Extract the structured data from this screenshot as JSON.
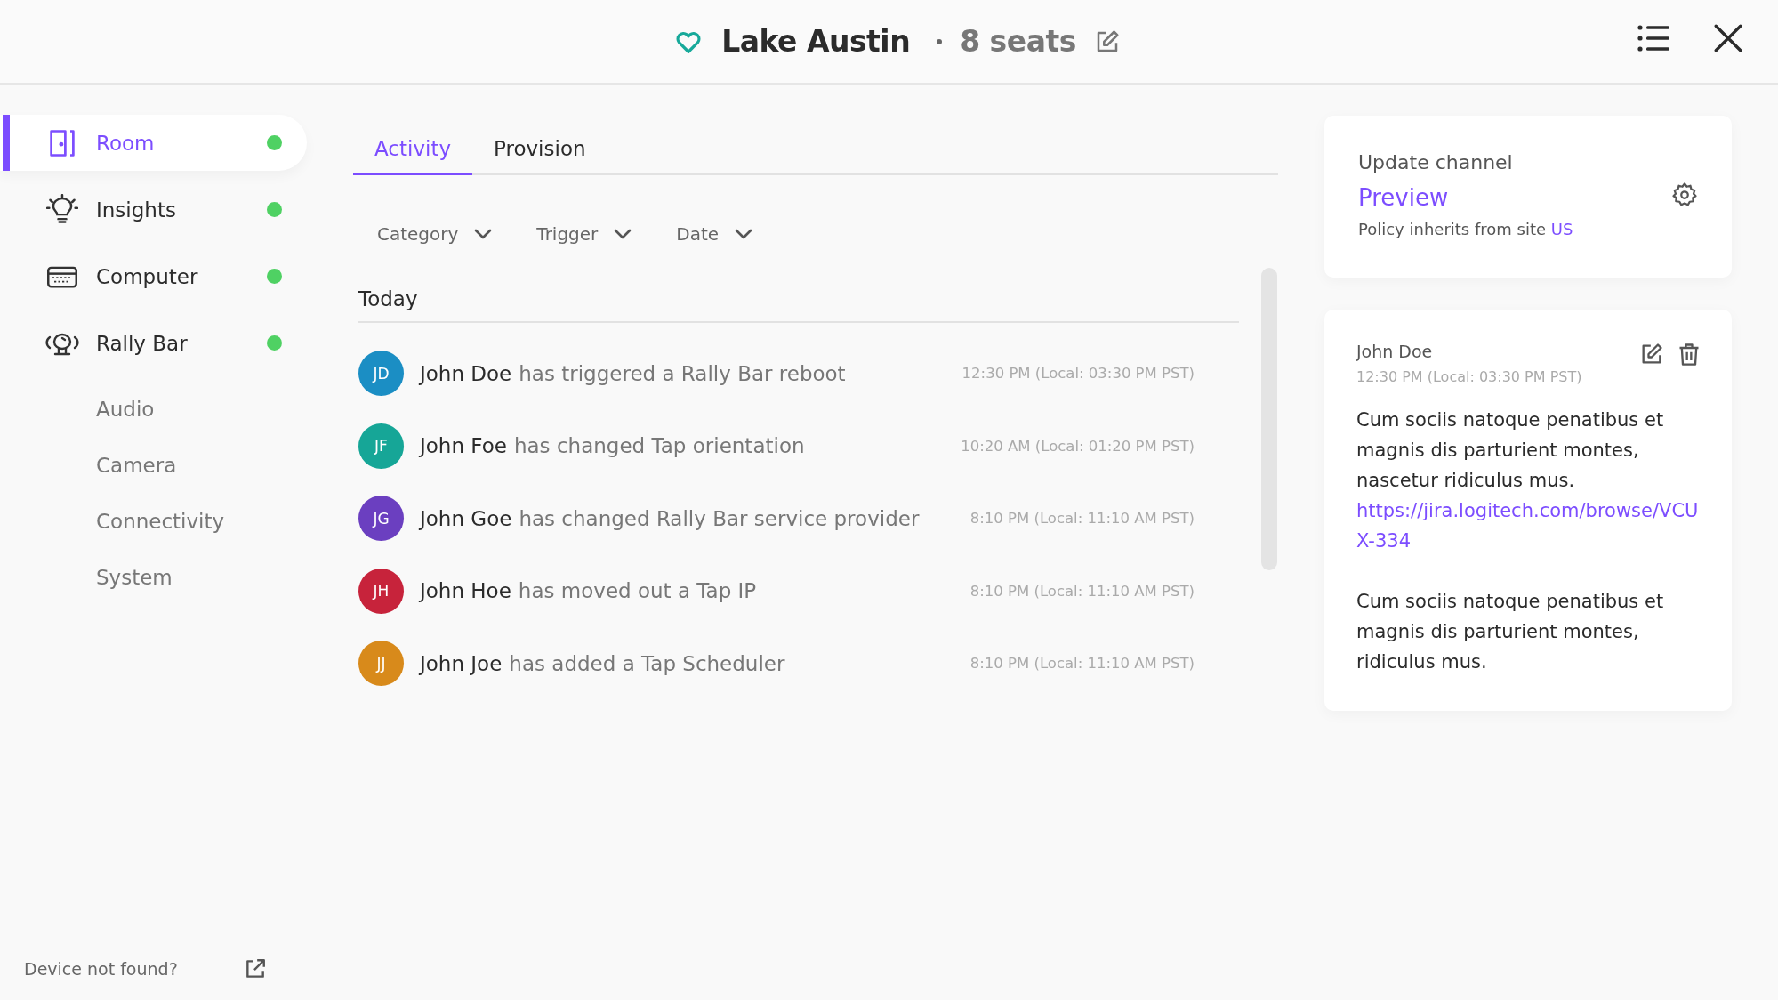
{
  "header": {
    "title": "Lake Austin",
    "seats": "8 seats"
  },
  "sidebar": {
    "items": [
      {
        "label": "Room",
        "selected": true,
        "color": "#4fd163"
      },
      {
        "label": "Insights",
        "selected": false,
        "color": "#4fd163"
      },
      {
        "label": "Computer",
        "selected": false,
        "color": "#4fd163"
      },
      {
        "label": "Rally Bar",
        "selected": false,
        "color": "#4fd163",
        "children": [
          {
            "label": "Audio",
            "selected": false
          },
          {
            "label": "Camera",
            "selected": false
          },
          {
            "label": "Connectivity",
            "selected": false
          },
          {
            "label": "System",
            "selected": false
          }
        ]
      }
    ],
    "footer": "Device not found?"
  },
  "tabs": [
    {
      "label": "Activity",
      "selected": true
    },
    {
      "label": "Provision",
      "selected": false
    }
  ],
  "filters": [
    "Category",
    "Trigger",
    "Date"
  ],
  "group": "Today",
  "activities": [
    {
      "initials": "JD",
      "color": "#1b8ec4",
      "name": "John Doe",
      "action": "has triggered a Rally Bar reboot",
      "time": "12:30 PM (Local: 03:30 PM PST)"
    },
    {
      "initials": "JF",
      "color": "#16a697",
      "name": "John Foe",
      "action": "has changed Tap orientation",
      "time": "10:20 AM (Local: 01:20 PM PST)"
    },
    {
      "initials": "JG",
      "color": "#6b3fc0",
      "name": "John Goe",
      "action": "has changed Rally Bar service provider",
      "time": "8:10 PM (Local: 11:10 AM PST)"
    },
    {
      "initials": "JH",
      "color": "#c7233b",
      "name": "John Hoe",
      "action": "has moved out a Tap IP",
      "time": "8:10 PM (Local: 11:10 AM PST)"
    },
    {
      "initials": "JJ",
      "color": "#d88a1b",
      "name": "John Joe",
      "action": "has added a Tap Scheduler",
      "time": "8:10 PM (Local: 11:10 AM PST)"
    }
  ],
  "update_channel": {
    "label": "Update channel",
    "value": "Preview",
    "policy": "Policy inherits from site",
    "site": "US"
  },
  "note": {
    "author": "John Doe",
    "time": "12:30 PM (Local: 03:30 PM PST)",
    "paragraphs": [
      {
        "text": "Cum sociis natoque penatibus et magnis dis parturient montes, nascetur ridiculus mus.",
        "link": "https://jira.logitech.com/browse/VCUX-334"
      },
      {
        "text": "Cum sociis natoque penatibus et magnis dis parturient montes, ridiculus mus."
      }
    ]
  }
}
